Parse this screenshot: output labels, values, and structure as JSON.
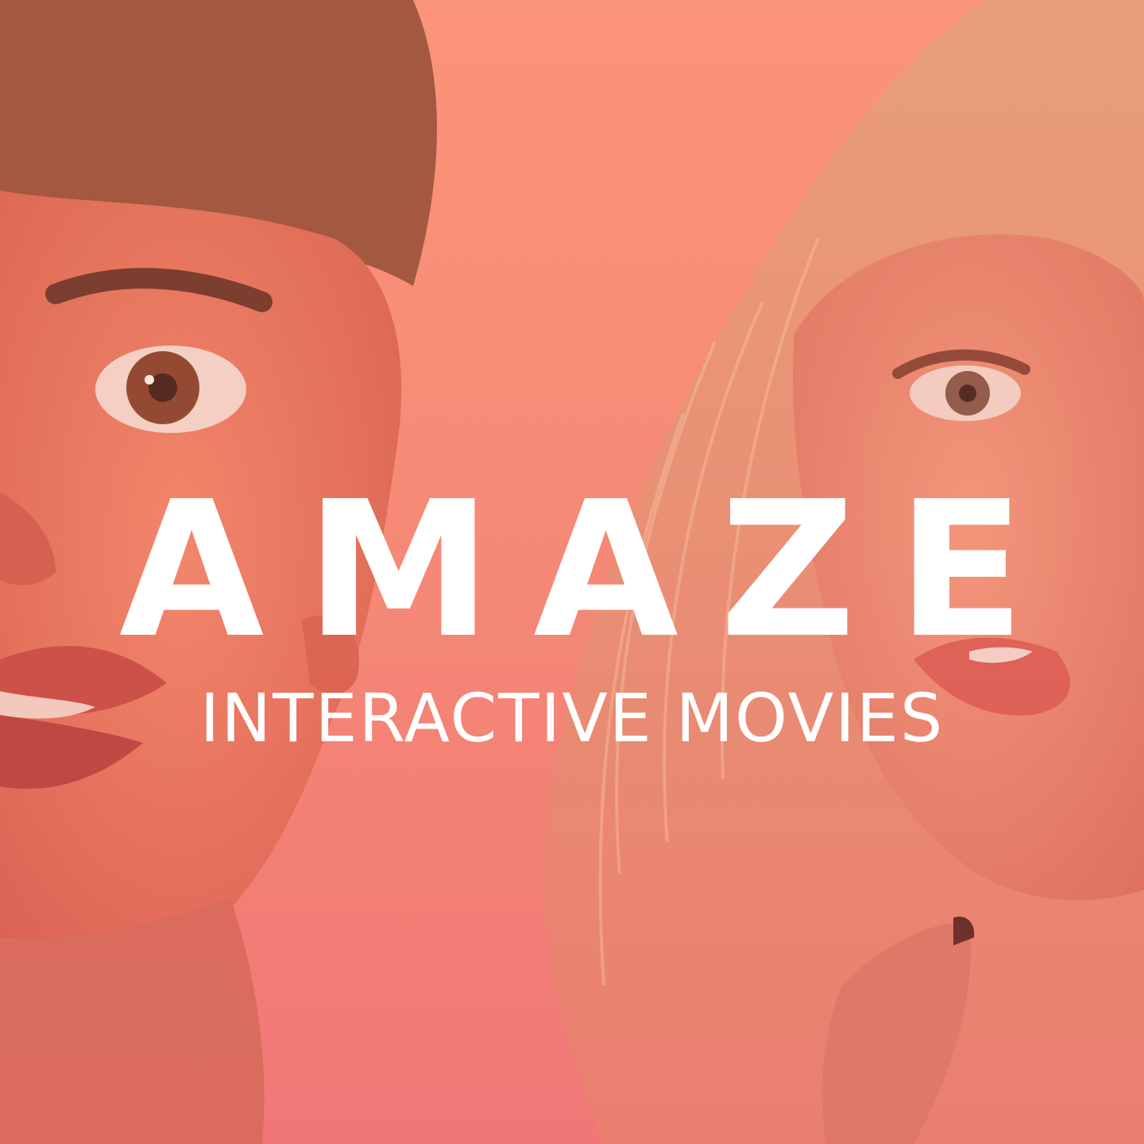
{
  "brand": {
    "title": "AMAZE",
    "tagline": "INTERACTIVE MOVIES"
  },
  "colors": {
    "overlay_top": "#f9937a",
    "overlay_bottom": "#f07978",
    "text": "#ffffff"
  },
  "artwork": {
    "left_subject": "man-face-surprised",
    "right_subject": "woman-face-blonde"
  }
}
